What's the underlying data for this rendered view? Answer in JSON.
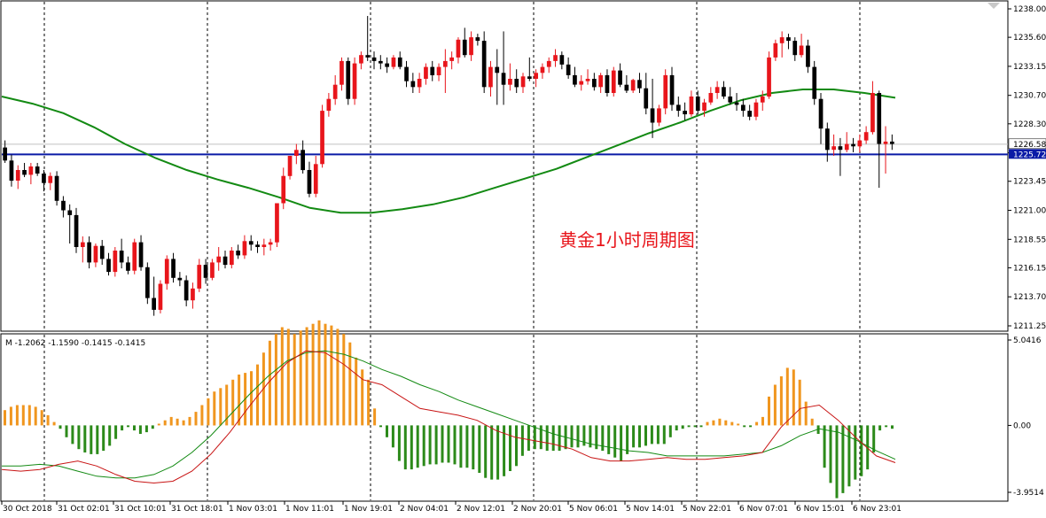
{
  "chart_data": [
    {
      "type": "candlestick",
      "title": "",
      "overlay_text": "黄金1小时周期图",
      "ylim": [
        1211.25,
        1238.0
      ],
      "y_ticks": [
        "1238.00",
        "1235.60",
        "1233.15",
        "1230.70",
        "1228.30",
        "1225.85",
        "1223.45",
        "1221.00",
        "1218.55",
        "1216.15",
        "1213.70",
        "1211.25"
      ],
      "price_labels": {
        "last": "1226.58",
        "horizontal_line": "1225.72"
      },
      "horizontal_line_value": 1225.72,
      "last_price_value": 1226.58,
      "x_labels": [
        "30 Oct 2018",
        "31 Oct 02:01",
        "31 Oct 10:01",
        "31 Oct 18:01",
        "1 Nov 03:01",
        "1 Nov 11:01",
        "1 Nov 19:01",
        "2 Nov 04:01",
        "2 Nov 12:01",
        "2 Nov 20:01",
        "5 Nov 06:01",
        "5 Nov 14:01",
        "5 Nov 22:01",
        "6 Nov 07:01",
        "6 Nov 15:01",
        "6 Nov 23:01"
      ],
      "ohlc": [
        [
          1226.3,
          1226.9,
          1225.0,
          1225.2
        ],
        [
          1225.2,
          1225.7,
          1223.0,
          1223.5
        ],
        [
          1223.5,
          1224.8,
          1222.8,
          1224.4
        ],
        [
          1224.4,
          1225.0,
          1223.8,
          1224.0
        ],
        [
          1224.0,
          1225.0,
          1223.2,
          1224.7
        ],
        [
          1224.7,
          1225.0,
          1223.9,
          1224.1
        ],
        [
          1224.1,
          1224.4,
          1222.6,
          1223.3
        ],
        [
          1223.3,
          1224.2,
          1222.7,
          1223.9
        ],
        [
          1223.9,
          1224.3,
          1221.4,
          1221.8
        ],
        [
          1221.8,
          1222.2,
          1220.4,
          1221.0
        ],
        [
          1221.0,
          1221.5,
          1218.2,
          1220.6
        ],
        [
          1220.6,
          1221.2,
          1217.4,
          1217.9
        ],
        [
          1217.9,
          1218.8,
          1216.6,
          1218.3
        ],
        [
          1218.3,
          1218.8,
          1216.1,
          1216.6
        ],
        [
          1216.6,
          1218.2,
          1216.2,
          1218.0
        ],
        [
          1218.0,
          1218.5,
          1216.4,
          1216.9
        ],
        [
          1216.9,
          1217.4,
          1215.5,
          1215.8
        ],
        [
          1215.8,
          1217.9,
          1215.4,
          1217.6
        ],
        [
          1217.6,
          1218.6,
          1216.1,
          1216.6
        ],
        [
          1216.6,
          1217.1,
          1215.6,
          1215.9
        ],
        [
          1215.9,
          1218.6,
          1215.6,
          1218.3
        ],
        [
          1218.3,
          1218.9,
          1215.9,
          1216.2
        ],
        [
          1216.2,
          1216.6,
          1213.1,
          1213.6
        ],
        [
          1213.6,
          1215.4,
          1212.1,
          1212.6
        ],
        [
          1212.6,
          1215.1,
          1212.3,
          1214.8
        ],
        [
          1214.8,
          1217.2,
          1214.3,
          1216.9
        ],
        [
          1216.9,
          1217.4,
          1214.9,
          1215.3
        ],
        [
          1215.3,
          1215.8,
          1214.6,
          1215.1
        ],
        [
          1215.1,
          1215.5,
          1212.9,
          1213.4
        ],
        [
          1213.4,
          1214.9,
          1212.7,
          1214.4
        ],
        [
          1214.4,
          1216.9,
          1214.1,
          1216.4
        ],
        [
          1216.4,
          1216.9,
          1214.8,
          1215.3
        ],
        [
          1215.3,
          1216.9,
          1215.1,
          1216.6
        ],
        [
          1216.6,
          1217.9,
          1215.9,
          1217.1
        ],
        [
          1217.1,
          1217.6,
          1216.1,
          1216.4
        ],
        [
          1216.4,
          1217.9,
          1216.1,
          1217.6
        ],
        [
          1217.6,
          1218.1,
          1216.9,
          1217.2
        ],
        [
          1217.2,
          1218.9,
          1216.9,
          1218.4
        ],
        [
          1218.4,
          1218.9,
          1217.6,
          1218.1
        ],
        [
          1218.1,
          1218.4,
          1217.4,
          1217.9
        ],
        [
          1217.9,
          1218.6,
          1217.2,
          1218.1
        ],
        [
          1218.1,
          1218.6,
          1217.6,
          1218.3
        ],
        [
          1218.3,
          1221.1,
          1217.9,
          1221.6
        ],
        [
          1221.6,
          1224.6,
          1221.1,
          1223.9
        ],
        [
          1223.9,
          1225.6,
          1223.6,
          1225.6
        ],
        [
          1225.6,
          1226.6,
          1224.9,
          1226.1
        ],
        [
          1226.1,
          1226.9,
          1224.1,
          1224.4
        ],
        [
          1224.4,
          1225.1,
          1222.1,
          1222.4
        ],
        [
          1222.4,
          1225.6,
          1222.1,
          1224.9
        ],
        [
          1224.9,
          1229.9,
          1224.6,
          1229.4
        ],
        [
          1229.4,
          1230.9,
          1228.9,
          1230.4
        ],
        [
          1230.4,
          1232.4,
          1229.9,
          1231.6
        ],
        [
          1231.6,
          1233.9,
          1231.1,
          1233.6
        ],
        [
          1233.6,
          1233.9,
          1229.9,
          1230.4
        ],
        [
          1230.4,
          1233.9,
          1229.9,
          1233.4
        ],
        [
          1233.4,
          1234.4,
          1232.9,
          1234.1
        ],
        [
          1234.1,
          1237.4,
          1233.6,
          1233.9
        ],
        [
          1233.9,
          1234.4,
          1232.9,
          1233.6
        ],
        [
          1233.6,
          1234.1,
          1232.9,
          1233.4
        ],
        [
          1233.4,
          1233.9,
          1232.6,
          1233.1
        ],
        [
          1233.1,
          1234.1,
          1232.9,
          1233.9
        ],
        [
          1233.9,
          1234.4,
          1232.9,
          1233.1
        ],
        [
          1233.1,
          1233.6,
          1231.4,
          1231.9
        ],
        [
          1231.9,
          1232.6,
          1230.9,
          1231.4
        ],
        [
          1231.4,
          1232.6,
          1230.9,
          1232.1
        ],
        [
          1232.1,
          1233.4,
          1231.6,
          1233.1
        ],
        [
          1233.1,
          1233.6,
          1231.9,
          1232.4
        ],
        [
          1232.4,
          1233.4,
          1231.9,
          1233.1
        ],
        [
          1233.1,
          1234.6,
          1230.9,
          1233.6
        ],
        [
          1233.6,
          1234.4,
          1232.9,
          1233.9
        ],
        [
          1233.9,
          1235.6,
          1233.4,
          1235.4
        ],
        [
          1235.4,
          1236.4,
          1233.9,
          1234.1
        ],
        [
          1234.1,
          1236.1,
          1233.6,
          1235.6
        ],
        [
          1235.6,
          1235.9,
          1234.9,
          1235.3
        ],
        [
          1235.3,
          1236.1,
          1230.9,
          1231.4
        ],
        [
          1231.4,
          1233.6,
          1230.6,
          1233.1
        ],
        [
          1233.1,
          1234.6,
          1229.9,
          1232.6
        ],
        [
          1232.6,
          1236.1,
          1229.9,
          1231.6
        ],
        [
          1231.6,
          1233.4,
          1231.1,
          1232.1
        ],
        [
          1232.1,
          1232.9,
          1230.9,
          1231.4
        ],
        [
          1231.4,
          1232.6,
          1230.9,
          1232.3
        ],
        [
          1232.3,
          1233.9,
          1231.9,
          1232.1
        ],
        [
          1232.1,
          1232.9,
          1231.4,
          1232.6
        ],
        [
          1232.6,
          1233.4,
          1232.1,
          1233.1
        ],
        [
          1233.1,
          1233.9,
          1232.6,
          1233.6
        ],
        [
          1233.6,
          1234.6,
          1233.1,
          1234.1
        ],
        [
          1234.1,
          1234.4,
          1232.9,
          1233.3
        ],
        [
          1233.3,
          1233.9,
          1232.1,
          1232.4
        ],
        [
          1232.4,
          1233.1,
          1231.4,
          1231.6
        ],
        [
          1231.6,
          1232.4,
          1231.1,
          1231.9
        ],
        [
          1231.9,
          1232.9,
          1231.6,
          1232.1
        ],
        [
          1232.1,
          1232.6,
          1231.1,
          1231.4
        ],
        [
          1231.4,
          1232.6,
          1230.9,
          1232.4
        ],
        [
          1232.4,
          1232.9,
          1230.6,
          1230.9
        ],
        [
          1230.9,
          1233.1,
          1230.6,
          1232.8
        ],
        [
          1232.8,
          1233.4,
          1231.4,
          1231.6
        ],
        [
          1231.6,
          1232.4,
          1230.9,
          1231.1
        ],
        [
          1231.1,
          1232.1,
          1230.9,
          1232.0
        ],
        [
          1232.0,
          1232.6,
          1230.9,
          1231.3
        ],
        [
          1231.3,
          1232.6,
          1229.1,
          1229.6
        ],
        [
          1229.6,
          1232.1,
          1227.1,
          1228.4
        ],
        [
          1228.4,
          1229.9,
          1228.1,
          1229.6
        ],
        [
          1229.6,
          1232.9,
          1229.1,
          1232.4
        ],
        [
          1232.4,
          1233.1,
          1229.4,
          1229.9
        ],
        [
          1229.9,
          1230.6,
          1228.9,
          1229.4
        ],
        [
          1229.4,
          1230.1,
          1228.6,
          1229.1
        ],
        [
          1229.1,
          1231.1,
          1228.9,
          1230.6
        ],
        [
          1230.6,
          1231.1,
          1229.1,
          1229.4
        ],
        [
          1229.4,
          1230.4,
          1228.9,
          1230.1
        ],
        [
          1230.1,
          1231.4,
          1229.9,
          1230.9
        ],
        [
          1230.9,
          1231.9,
          1230.4,
          1231.4
        ],
        [
          1231.4,
          1231.9,
          1230.4,
          1230.6
        ],
        [
          1230.6,
          1231.4,
          1229.9,
          1230.1
        ],
        [
          1230.1,
          1230.9,
          1229.4,
          1229.9
        ],
        [
          1229.9,
          1230.4,
          1228.9,
          1229.4
        ],
        [
          1229.4,
          1229.9,
          1228.6,
          1228.9
        ],
        [
          1228.9,
          1230.4,
          1228.6,
          1230.1
        ],
        [
          1230.1,
          1231.1,
          1229.4,
          1230.6
        ],
        [
          1230.6,
          1234.4,
          1230.4,
          1233.9
        ],
        [
          1233.9,
          1235.4,
          1233.6,
          1235.1
        ],
        [
          1235.1,
          1236.1,
          1233.9,
          1235.6
        ],
        [
          1235.6,
          1235.9,
          1234.6,
          1235.3
        ],
        [
          1235.3,
          1235.6,
          1233.6,
          1234.1
        ],
        [
          1234.1,
          1235.9,
          1233.9,
          1234.9
        ],
        [
          1234.9,
          1235.4,
          1232.6,
          1233.1
        ],
        [
          1233.1,
          1233.6,
          1229.9,
          1230.4
        ],
        [
          1230.4,
          1230.9,
          1226.6,
          1227.9
        ],
        [
          1227.9,
          1228.4,
          1225.1,
          1226.1
        ],
        [
          1226.1,
          1227.4,
          1225.6,
          1226.4
        ],
        [
          1226.4,
          1227.1,
          1223.9,
          1226.1
        ],
        [
          1226.1,
          1227.6,
          1225.9,
          1226.6
        ],
        [
          1226.6,
          1227.1,
          1225.9,
          1226.4
        ],
        [
          1226.4,
          1227.4,
          1225.9,
          1226.9
        ],
        [
          1226.9,
          1228.1,
          1226.6,
          1227.6
        ],
        [
          1227.6,
          1231.9,
          1227.4,
          1230.9
        ],
        [
          1230.9,
          1231.1,
          1222.9,
          1226.6
        ],
        [
          1226.6,
          1228.1,
          1224.1,
          1226.8
        ],
        [
          1226.8,
          1227.4,
          1226.1,
          1226.6
        ]
      ],
      "up_color": "#e8151b",
      "down_color": "#000000",
      "ma_color": "#138a13",
      "hline_color": "#0a1aa6",
      "ma_series": [
        1230.6,
        1230.0,
        1229.2,
        1228.0,
        1226.6,
        1225.4,
        1224.4,
        1223.6,
        1222.9,
        1222.1,
        1221.2,
        1220.8,
        1220.8,
        1221.1,
        1221.5,
        1222.1,
        1222.9,
        1223.7,
        1224.5,
        1225.5,
        1226.5,
        1227.5,
        1228.4,
        1229.4,
        1230.3,
        1230.9,
        1231.2,
        1231.2,
        1230.9,
        1230.5
      ],
      "y_label": "",
      "x_label": ""
    },
    {
      "type": "bar",
      "title": "",
      "header_label": "M -1.2062 -1.1590 -0.1415 -0.1415",
      "ylim": [
        -3.9514,
        5.0416
      ],
      "y_ticks": [
        "5.0416",
        "0.00",
        "-3.9514"
      ],
      "pos_color": "#f0961f",
      "neg_color": "#2c8a1a",
      "histogram": [
        0.9,
        1.1,
        1.2,
        1.2,
        1.2,
        1.1,
        0.9,
        0.6,
        0.2,
        -0.2,
        -0.7,
        -1.1,
        -1.4,
        -1.6,
        -1.7,
        -1.7,
        -1.5,
        -1.2,
        -0.8,
        -0.3,
        -0.1,
        -0.3,
        -0.5,
        -0.4,
        -0.2,
        0.1,
        0.3,
        0.5,
        0.4,
        0.3,
        0.5,
        0.8,
        1.2,
        1.6,
        2.0,
        2.2,
        2.4,
        2.7,
        3.0,
        3.1,
        3.2,
        3.6,
        4.3,
        5.0,
        5.4,
        5.8,
        5.7,
        5.4,
        5.6,
        5.8,
        6.0,
        6.2,
        6.0,
        5.9,
        5.7,
        5.4,
        4.9,
        4.0,
        3.3,
        2.7,
        1.0,
        -0.1,
        -0.7,
        -1.3,
        -2.1,
        -2.6,
        -2.6,
        -2.5,
        -2.4,
        -2.3,
        -2.3,
        -2.2,
        -2.2,
        -2.3,
        -2.5,
        -2.5,
        -2.6,
        -2.8,
        -3.1,
        -3.2,
        -3.2,
        -3.0,
        -2.7,
        -2.4,
        -1.8,
        -1.5,
        -1.4,
        -1.4,
        -1.5,
        -1.5,
        -1.5,
        -1.4,
        -1.3,
        -1.3,
        -1.2,
        -1.3,
        -1.4,
        -1.5,
        -1.7,
        -1.9,
        -2.1,
        -1.7,
        -1.3,
        -1.3,
        -1.2,
        -1.1,
        -1.1,
        -1.1,
        -0.7,
        -0.3,
        -0.2,
        -0.1,
        -0.1,
        -0.1,
        0.2,
        0.3,
        0.4,
        0.3,
        0.2,
        0.1,
        -0.1,
        -0.1,
        0.2,
        0.5,
        1.7,
        2.4,
        2.9,
        3.4,
        3.3,
        2.7,
        1.4,
        0.4,
        -0.5,
        -2.5,
        -3.4,
        -4.3,
        -4.0,
        -3.6,
        -3.2,
        -3.0,
        -2.6,
        -1.6,
        -0.3,
        -0.1,
        -0.2
      ],
      "signal_red": [
        -2.6,
        -2.7,
        -2.6,
        -2.3,
        -2.1,
        -2.4,
        -2.9,
        -3.3,
        -3.4,
        -3.3,
        -2.7,
        -1.7,
        -0.4,
        1.1,
        2.5,
        3.7,
        4.4,
        4.3,
        3.6,
        2.7,
        2.4,
        1.7,
        1.0,
        0.8,
        0.6,
        0.3,
        -0.3,
        -0.7,
        -0.9,
        -1.1,
        -1.4,
        -1.9,
        -2.1,
        -2.1,
        -2.0,
        -1.9,
        -2.0,
        -2.0,
        -1.9,
        -1.8,
        -1.6,
        -0.1,
        1.0,
        1.2,
        0.3,
        -0.8,
        -1.8,
        -2.2
      ],
      "signal_green": [
        -2.4,
        -2.4,
        -2.3,
        -2.4,
        -2.7,
        -3.0,
        -3.1,
        -3.1,
        -2.9,
        -2.4,
        -1.6,
        -0.6,
        0.6,
        1.8,
        2.9,
        3.8,
        4.3,
        4.4,
        4.2,
        3.8,
        3.3,
        2.9,
        2.4,
        2.0,
        1.5,
        1.1,
        0.7,
        0.3,
        -0.1,
        -0.5,
        -0.8,
        -1.1,
        -1.3,
        -1.5,
        -1.6,
        -1.8,
        -1.8,
        -1.8,
        -1.8,
        -1.7,
        -1.6,
        -1.2,
        -0.6,
        -0.2,
        -0.4,
        -0.9,
        -1.5,
        -2.0
      ]
    }
  ]
}
